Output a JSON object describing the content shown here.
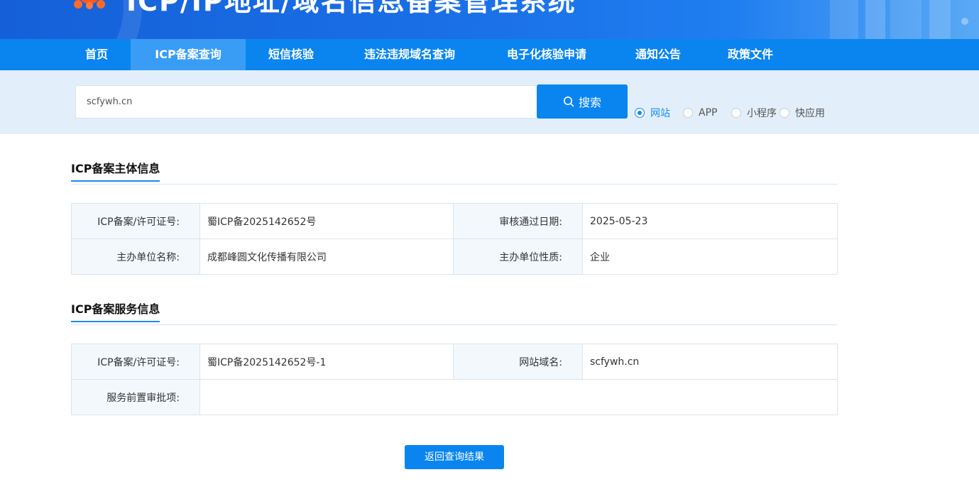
{
  "header": {
    "title": "ICP/IP地址/域名信息备案管理系统"
  },
  "nav": {
    "items": [
      "首页",
      "ICP备案查询",
      "短信核验",
      "违法违规域名查询",
      "电子化核验申请",
      "通知公告",
      "政策文件"
    ],
    "active": "ICP备案查询"
  },
  "search": {
    "value": "scfywh.cn",
    "button_label": "搜索",
    "options": [
      "网站",
      "APP",
      "小程序",
      "快应用"
    ],
    "selected": "网站"
  },
  "subject_info": {
    "title": "ICP备案主体信息",
    "rows": [
      [
        "ICP备案/许可证号:",
        "蜀ICP备2025142652号",
        "审核通过日期:",
        "2025-05-23"
      ],
      [
        "主办单位名称:",
        "成都峰圆文化传播有限公司",
        "主办单位性质:",
        "企业"
      ]
    ]
  },
  "service_info": {
    "title": "ICP备案服务信息",
    "license_label": "ICP备案/许可证号:",
    "license_value": "蜀ICP备2025142652号-1",
    "domain_label": "网站域名:",
    "domain_value": "scfywh.cn",
    "approval_label": "服务前置审批项:",
    "approval_value": ""
  },
  "back_button_label": "返回查询结果",
  "colors": {
    "primary": "#0a85f0",
    "nav_active": "#3a9df5",
    "search_band": "#e2effb"
  }
}
